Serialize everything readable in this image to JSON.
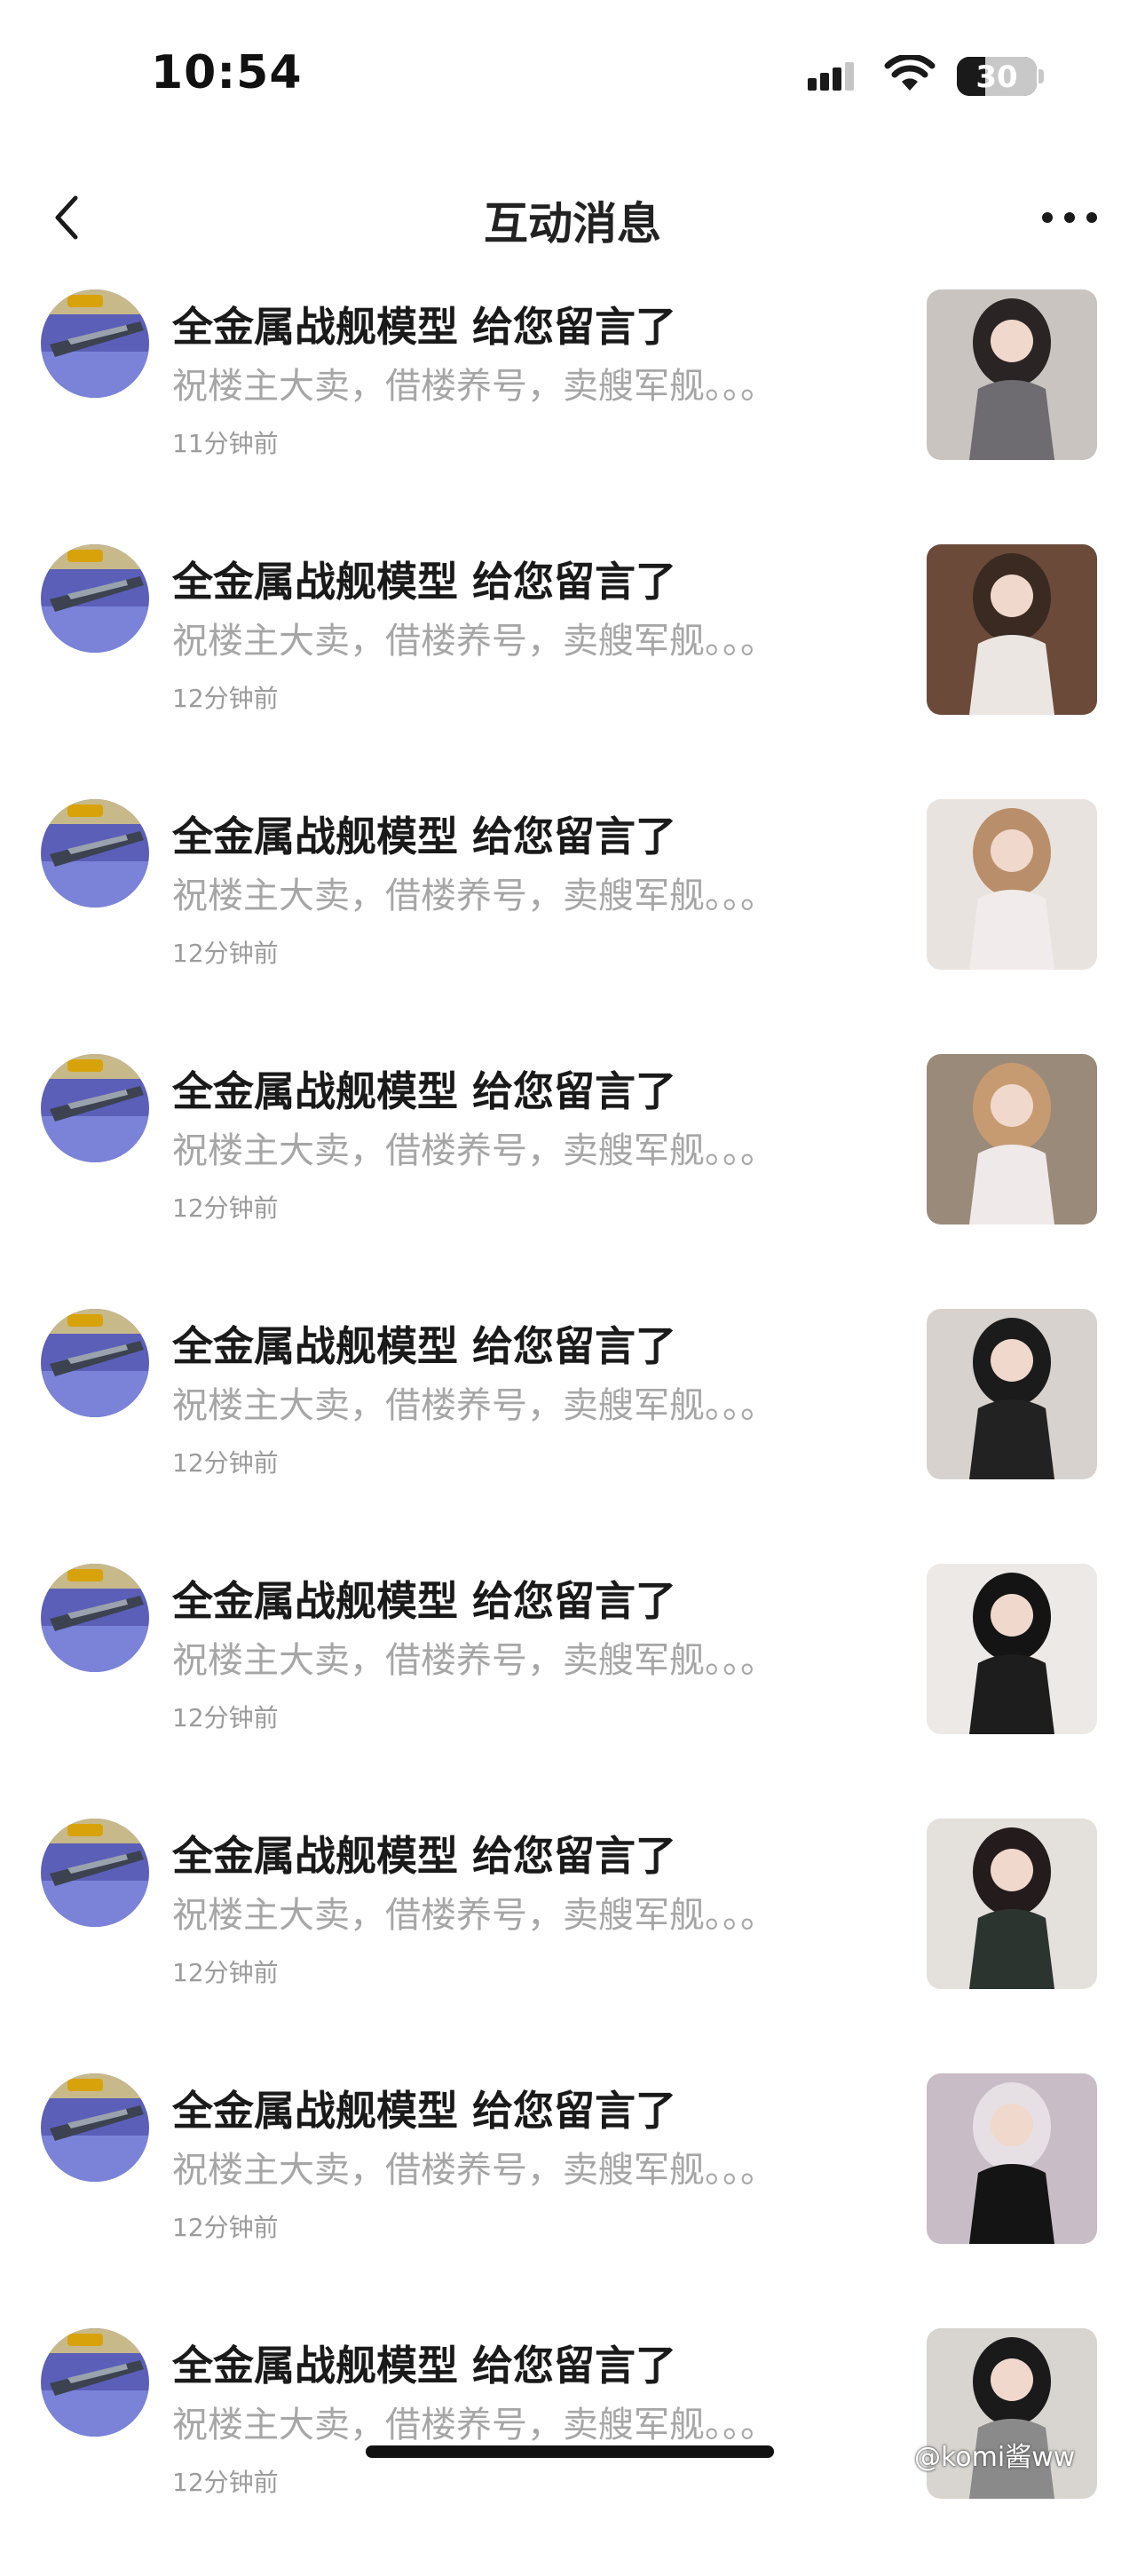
{
  "status_bar": {
    "time": "10:54",
    "battery": "30"
  },
  "nav": {
    "title": "互动消息",
    "back_icon": "chevron-left-icon",
    "more_icon": "more-horizontal-icon"
  },
  "messages": [
    {
      "title": "全金属战舰模型 给您留言了",
      "preview": "祝楼主大卖，借楼养号，卖艘军舰。。。",
      "time": "11分钟前",
      "thumb": "dark-hair-grey-top"
    },
    {
      "title": "全金属战舰模型 给您留言了",
      "preview": "祝楼主大卖，借楼养号，卖艘军舰。。。",
      "time": "12分钟前",
      "thumb": "horns-white-top"
    },
    {
      "title": "全金属战舰模型 给您留言了",
      "preview": "祝楼主大卖，借楼养号，卖艘军舰。。。",
      "time": "12分钟前",
      "thumb": "cherry-dress"
    },
    {
      "title": "全金属战舰模型 给您留言了",
      "preview": "祝楼主大卖，借楼养号，卖艘军舰。。。",
      "time": "12分钟前",
      "thumb": "cherry-dress-kitchen"
    },
    {
      "title": "全金属战舰模型 给您留言了",
      "preview": "祝楼主大卖，借楼养号，卖艘军舰。。。",
      "time": "12分钟前",
      "thumb": "black-bodysuit"
    },
    {
      "title": "全金属战舰模型 给您留言了",
      "preview": "祝楼主大卖，借楼养号，卖艘军舰。。。",
      "time": "12分钟前",
      "thumb": "black-coat"
    },
    {
      "title": "全金属战舰模型 给您留言了",
      "preview": "祝楼主大卖，借楼养号，卖艘军舰。。。",
      "time": "12分钟前",
      "thumb": "black-dress-red-stockings"
    },
    {
      "title": "全金属战舰模型 给您留言了",
      "preview": "祝楼主大卖，借楼养号，卖艘军舰。。。",
      "time": "12分钟前",
      "thumb": "silver-hair-black"
    },
    {
      "title": "全金属战舰模型 给您留言了",
      "preview": "祝楼主大卖，借楼养号，卖艘军舰。。。",
      "time": "12分钟前",
      "thumb": "twin-tails-grey"
    }
  ],
  "watermark": "@komi酱ww",
  "colors": {
    "title": "#1a1a1a",
    "preview": "#a6a6a6",
    "time": "#9b9b9b",
    "background": "#ffffff"
  }
}
